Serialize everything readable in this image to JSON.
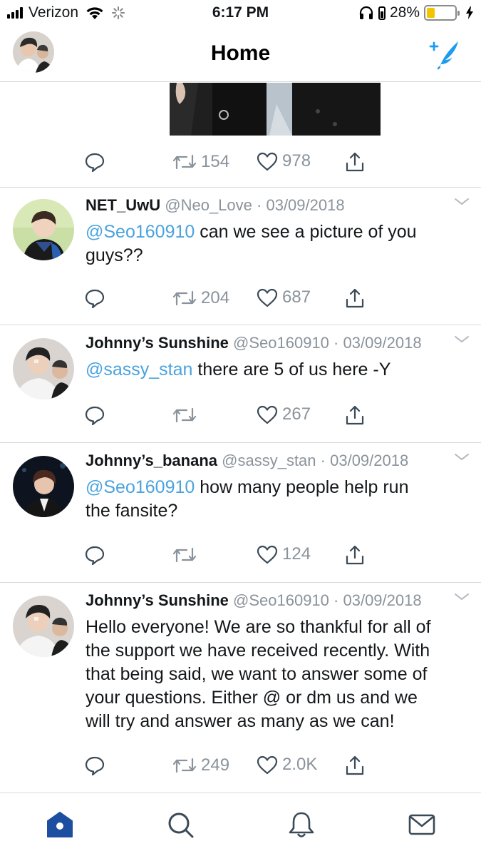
{
  "status_bar": {
    "carrier": "Verizon",
    "time": "6:17 PM",
    "battery_percent": "28%",
    "battery_level": 0.28,
    "icons": [
      "signal-icon",
      "wifi-icon",
      "activity-spinner-icon",
      "headphones-icon",
      "lock-rotation-icon",
      "battery-icon",
      "charging-bolt-icon"
    ]
  },
  "header": {
    "title": "Home",
    "avatar": "profile-avatar",
    "compose_icon": "compose-tweet-icon"
  },
  "top_tweet_actions": {
    "retweets": "154",
    "likes": "978"
  },
  "tweets": [
    {
      "name": "NET_UwU",
      "handle": "@Neo_Love",
      "date": "03/09/2018",
      "mention": "@Seo160910",
      "text_line1": " can we see a picture of you",
      "text_line2": "guys??",
      "retweets": "204",
      "likes": "687"
    },
    {
      "name": "Johnny’s Sunshine",
      "handle": "@Seo160910",
      "date": "03/09/2018",
      "mention": "@sassy_stan",
      "text_line1": " there are 5 of us here -Y",
      "retweets": "",
      "likes": "267"
    },
    {
      "name": "Johnny’s_banana",
      "handle": "@sassy_stan",
      "date": "03/09/2018",
      "mention": "@Seo160910",
      "text_line1": " how many people help run",
      "text_line2": "the fansite?",
      "retweets": "",
      "likes": "124"
    },
    {
      "name": "Johnny’s Sunshine",
      "handle": "@Seo160910",
      "date": "03/09/2018",
      "lines": [
        "Hello everyone! We are so thankful for all of",
        "the support we have received recently. With",
        "that being said, we want to answer some of",
        "your questions. Either @ or dm us and we",
        "will try and answer as many as we can!"
      ],
      "retweets": "249",
      "likes": "2.0K"
    }
  ],
  "colors": {
    "mention": "#4aa3df",
    "icon_gray": "#8a939b",
    "tab_active": "#1d4fa0",
    "compose": "#1d9bf0",
    "battery_fill": "#f5c400"
  },
  "tab_bar": {
    "tabs": [
      "home-tab",
      "search-tab",
      "notifications-tab",
      "messages-tab"
    ]
  }
}
